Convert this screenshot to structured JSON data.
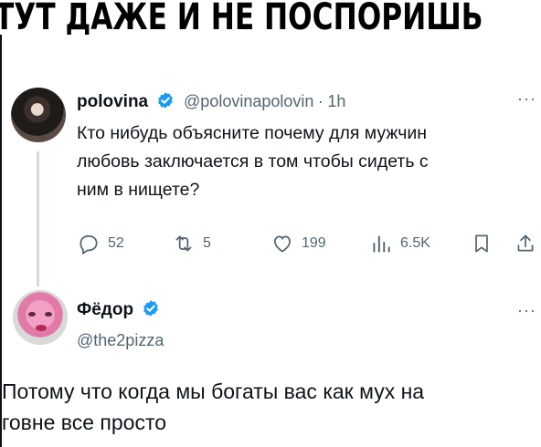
{
  "banner": {
    "text": "ТУТ ДАЖЕ И НЕ ПОСПОРИШЬ"
  },
  "tweet": {
    "author_name": "polovina",
    "handle": "@polovinapolovin",
    "separator": "·",
    "time": "1h",
    "more": "···",
    "text_lines": [
      "Кто нибудь объясните почему для мужчин",
      "любовь заключается в том чтобы сидеть с",
      "ним в нищете?"
    ],
    "actions": {
      "reply_count": "52",
      "retweet_count": "5",
      "like_count": "199",
      "views_count": "6.5K"
    }
  },
  "reply": {
    "author_name": "Фёдор",
    "handle": "@the2pizza",
    "more": "···",
    "text_lines": [
      "Потому что когда мы богаты вас как мух на",
      "говне все просто"
    ]
  },
  "colors": {
    "verified": "#1d9bf0",
    "muted": "#536471",
    "text": "#0f1419"
  },
  "icons": [
    "verified-badge-icon",
    "reply-icon",
    "retweet-icon",
    "like-icon",
    "views-icon",
    "bookmark-icon",
    "share-icon",
    "more-icon"
  ]
}
